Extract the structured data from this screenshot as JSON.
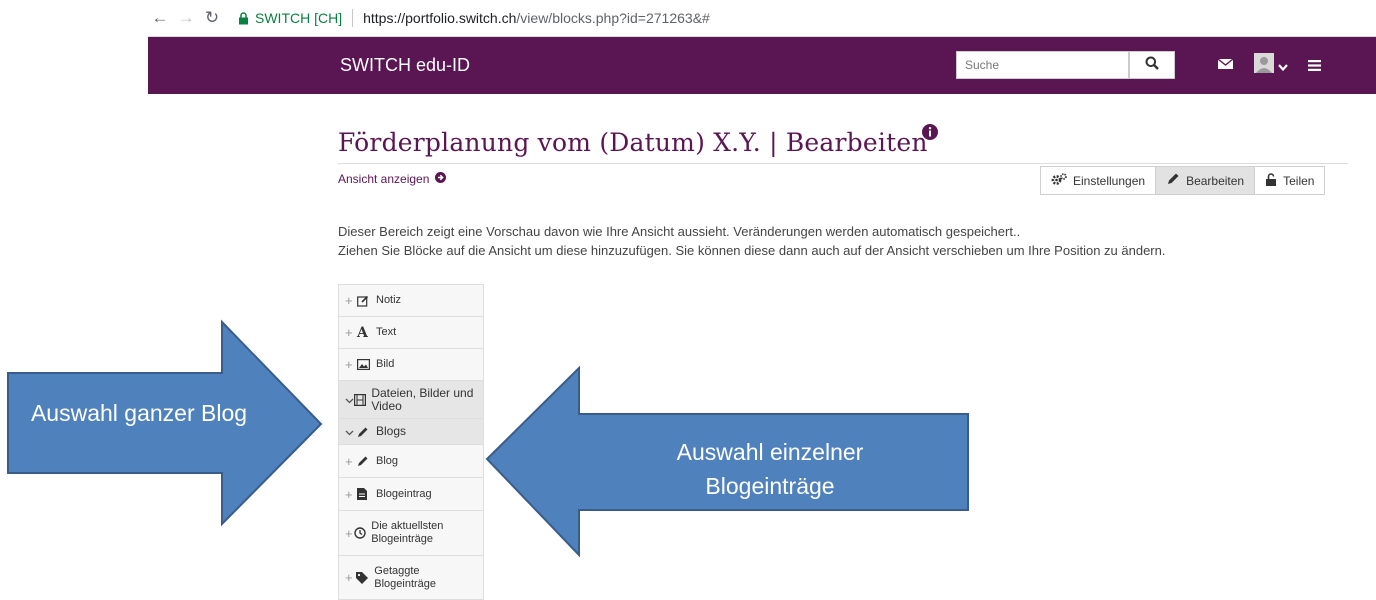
{
  "browser": {
    "site_badge": "SWITCH [CH]",
    "url_host": "https://portfolio.switch.ch",
    "url_path": "/view/blocks.php?id=271263&#"
  },
  "header": {
    "brand": "SWITCH edu-ID",
    "search_placeholder": "Suche",
    "color": "#5a1553"
  },
  "page": {
    "title": "Förderplanung vom (Datum) X.Y. | Bearbeiten",
    "view_link": "Ansicht anzeigen",
    "buttons": [
      {
        "label": "Einstellungen",
        "icon": "gears-icon",
        "active": false
      },
      {
        "label": "Bearbeiten",
        "icon": "pencil-icon",
        "active": true
      },
      {
        "label": "Teilen",
        "icon": "unlock-icon",
        "active": false
      }
    ],
    "description": [
      "Dieser Bereich zeigt eine Vorschau davon wie Ihre Ansicht aussieht. Veränderungen werden automatisch gespeichert..",
      "Ziehen Sie Blöcke auf die Ansicht um diese hinzuzufügen. Sie können diese dann auch auf der Ansicht verschieben um Ihre Position zu ändern."
    ]
  },
  "palette": {
    "items": [
      {
        "label": "Notiz",
        "icon": "note-edit-icon",
        "handle": "+"
      },
      {
        "label": "Text",
        "icon": "text-a-icon",
        "handle": "+"
      },
      {
        "label": "Bild",
        "icon": "image-icon",
        "handle": "+"
      },
      {
        "label": "Dateien, Bilder und Video",
        "icon": "film-icon",
        "handle": "chevron"
      },
      {
        "label": "Blogs",
        "icon": "pencil-icon",
        "handle": "chevron"
      },
      {
        "label": "Blog",
        "icon": "pencil-icon",
        "handle": "+"
      },
      {
        "label": "Blogeintrag",
        "icon": "document-icon",
        "handle": "+"
      },
      {
        "label": "Die aktuellsten Blogeinträge",
        "icon": "clock-icon",
        "handle": "+"
      },
      {
        "label": "Getaggte Blogeinträge",
        "icon": "tags-icon",
        "handle": "+"
      }
    ]
  },
  "callouts": {
    "left": "Auswahl ganzer Blog",
    "right": "Auswahl einzelner Blogeinträge",
    "fill": "#4f81bd",
    "stroke": "#385d8a"
  }
}
